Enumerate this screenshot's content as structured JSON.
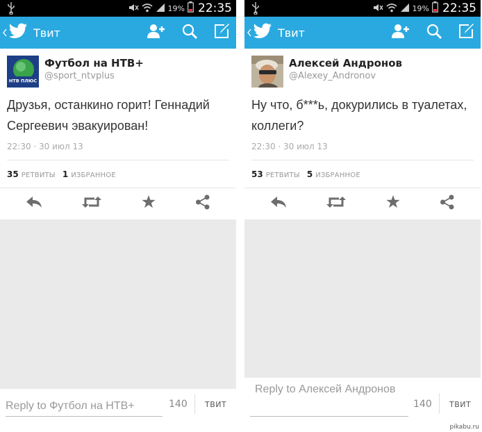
{
  "screens": [
    {
      "status": {
        "battery": "19%",
        "time": "22:35"
      },
      "appbar": {
        "title": "Твит"
      },
      "tweet": {
        "name": "Футбол на НТВ+",
        "handle": "@sport_ntvplus",
        "avatar_text": "НТВ ПЛЮС",
        "text": "Друзья, останкино горит! Геннадий Сергеевич эвакуирован!",
        "timestamp": "22:30 · 30 июл 13",
        "retweets_count": "35",
        "retweets_label": "РЕТВИТЫ",
        "favorites_count": "1",
        "favorites_label": "ИЗБРАННОЕ"
      },
      "reply": {
        "placeholder": "Reply to Футбол на НТВ+",
        "counter": "140",
        "send_label": "ТВИТ"
      }
    },
    {
      "status": {
        "battery": "19%",
        "time": "22:35"
      },
      "appbar": {
        "title": "Твит"
      },
      "tweet": {
        "name": "Алексей Андронов",
        "handle": "@Alexey_Andronov",
        "text": "Ну что, б***ь, докурились в туалетах, коллеги?",
        "timestamp": "22:30 · 30 июл 13",
        "retweets_count": "53",
        "retweets_label": "РЕТВИТЫ",
        "favorites_count": "5",
        "favorites_label": "ИЗБРАННОЕ"
      },
      "reply": {
        "placeholder": "Reply to Алексей Андронов",
        "counter": "140",
        "send_label": "ТВИТ"
      }
    }
  ],
  "watermark": "pikabu.ru",
  "colors": {
    "appbar": "#2aa9e0",
    "statusbar": "#000000",
    "empty_area": "#eaeaea",
    "action_icon": "#6d6d6d"
  }
}
